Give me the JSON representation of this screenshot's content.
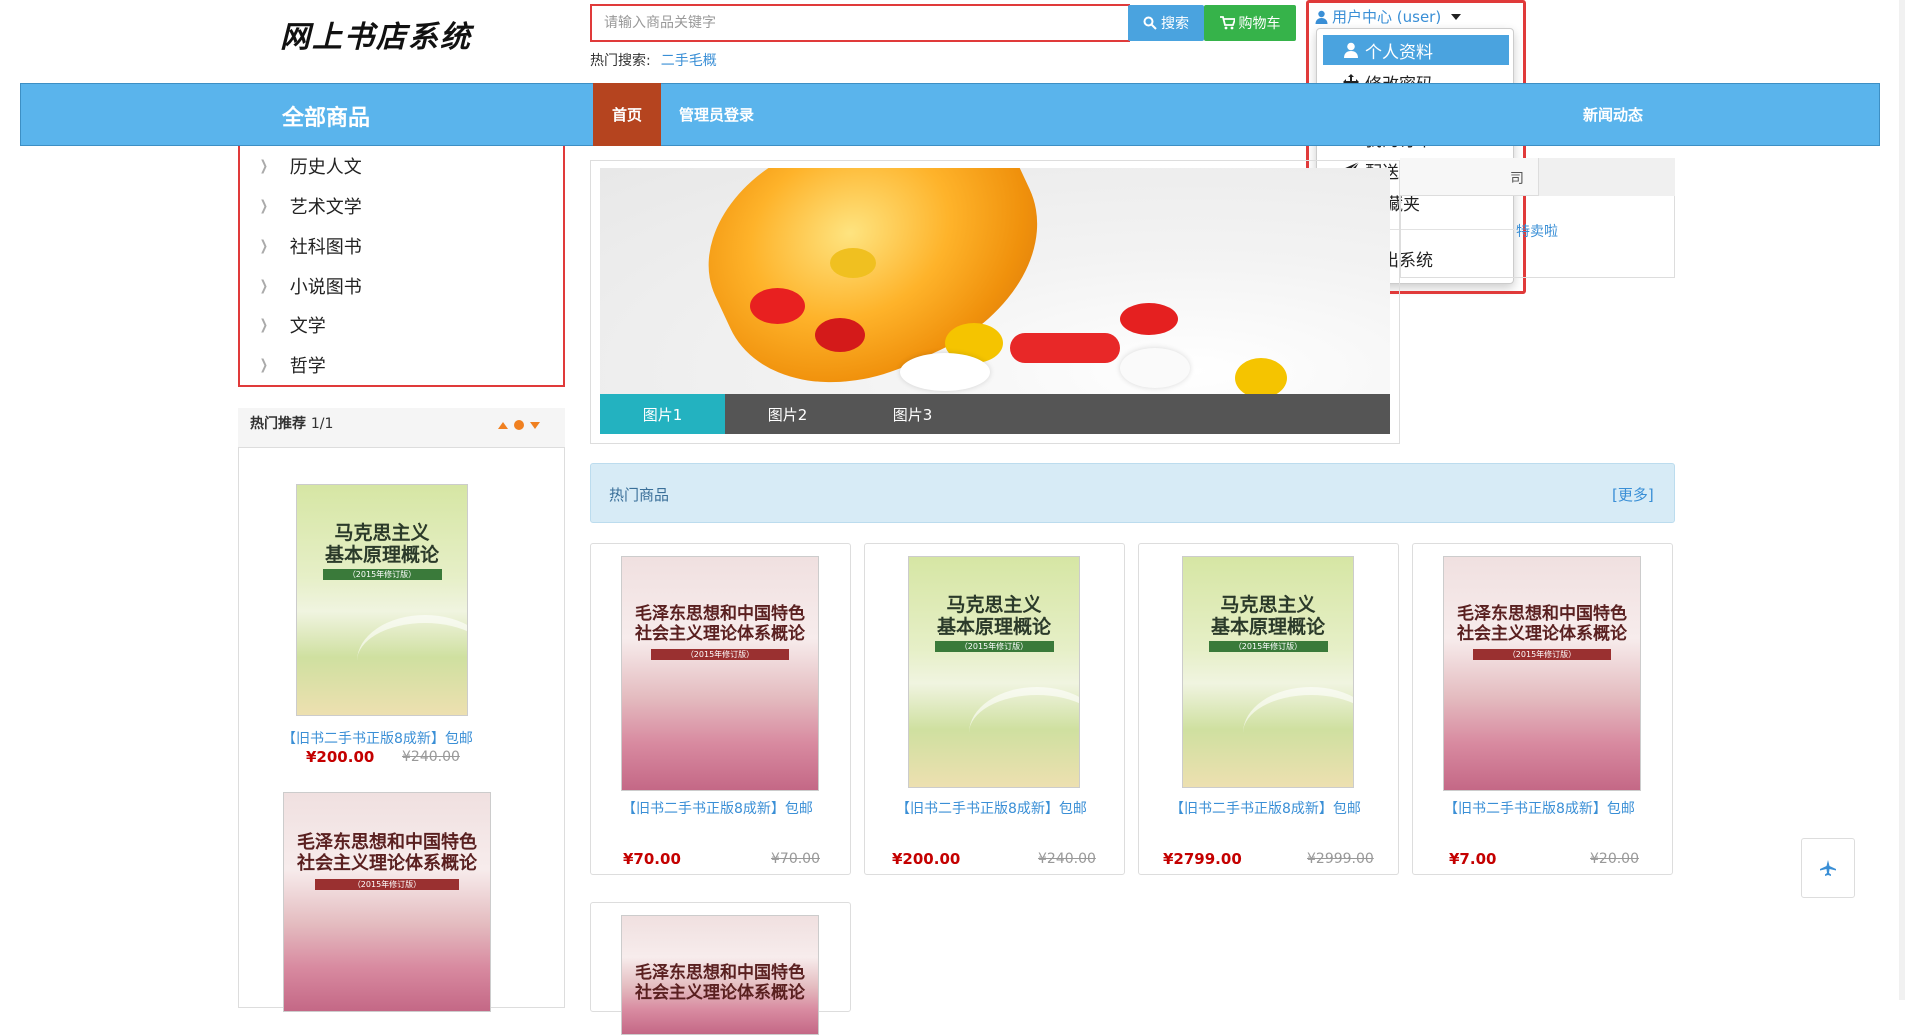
{
  "header": {
    "logo": "网上书店系统",
    "search_placeholder": "请输入商品关键字",
    "search_btn": "搜索",
    "cart_btn": "购物车",
    "hot_search_label": "热门搜索:",
    "hot_search_link": "二手毛概"
  },
  "user_menu": {
    "label": "用户中心 (user)",
    "items": [
      "个人资料",
      "修改密码",
      "我的订单",
      "配送地址",
      "收藏夹",
      "退出系统"
    ]
  },
  "nav": {
    "all_goods": "全部商品",
    "home": "首页",
    "admin_login": "管理员登录",
    "news": "新闻动态"
  },
  "categories": [
    "历史人文",
    "艺术文学",
    "社科图书",
    "小说图书",
    "文学",
    "哲学"
  ],
  "hot_recommend": {
    "title": "热门推荐",
    "page": "1/1",
    "item": {
      "link": "【旧书二手书正版8成新】包邮",
      "price": "¥200.00",
      "old_price": "¥240.00"
    }
  },
  "banner": {
    "tabs": [
      "图片1",
      "图片2",
      "图片3"
    ]
  },
  "news_fragments": {
    "tab_tail": "司",
    "line_tail": "特卖啦"
  },
  "hot_products": {
    "title": "热门商品",
    "more": "[更多]",
    "items": [
      {
        "link": "【旧书二手书正版8成新】包邮",
        "price": "¥70.00",
        "old_price": "¥70.00",
        "cover": "pink"
      },
      {
        "link": "【旧书二手书正版8成新】包邮",
        "price": "¥200.00",
        "old_price": "¥240.00",
        "cover": "green"
      },
      {
        "link": "【旧书二手书正版8成新】包邮",
        "price": "¥2799.00",
        "old_price": "¥2999.00",
        "cover": "green"
      },
      {
        "link": "【旧书二手书正版8成新】包邮",
        "price": "¥7.00",
        "old_price": "¥20.00",
        "cover": "pink"
      }
    ]
  },
  "book_titles": {
    "green": "马克思主义\n基本原理概论",
    "green_band": "（2015年修订版）",
    "pink": "毛泽东思想和中国特色\n社会主义理论体系概论",
    "pink_band": "（2015年修订版）"
  },
  "colors": {
    "nav_blue": "#5ab4ec",
    "home_active": "#b5441f",
    "search_blue": "#4aa3df",
    "cart_green": "#36b34a",
    "price_red": "#c40000",
    "tab_active": "#23b2c0"
  }
}
